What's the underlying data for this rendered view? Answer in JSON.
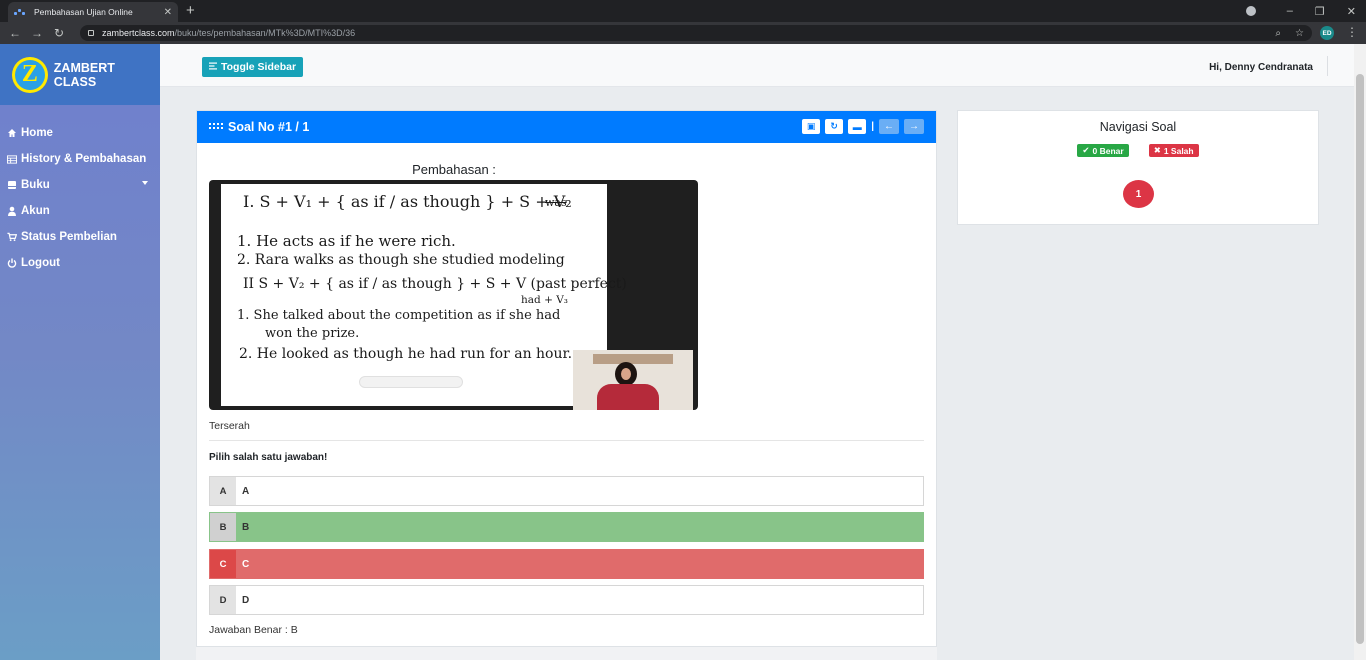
{
  "browser": {
    "tab_title": "Pembahasan Ujian Online",
    "url_host": "zambertclass.com",
    "url_path": "/buku/tes/pembahasan/MTk%3D/MTI%3D/36",
    "profile_initials": "ED"
  },
  "sidebar": {
    "logo_letter": "Z",
    "brand": "ZAMBERT CLASS",
    "items": [
      {
        "label": "Home",
        "icon": "home-icon"
      },
      {
        "label": "History & Pembahasan",
        "icon": "table-icon"
      },
      {
        "label": "Buku",
        "icon": "book-icon"
      },
      {
        "label": "Akun",
        "icon": "user-icon"
      },
      {
        "label": "Status Pembelian",
        "icon": "cart-icon"
      },
      {
        "label": "Logout",
        "icon": "power-icon"
      }
    ]
  },
  "topbar": {
    "toggle_label": "Toggle Sidebar",
    "greeting": "Hi, Denny Cendranata"
  },
  "question": {
    "header": "Soal No #1 / 1",
    "pembahasan_title": "Pembahasan :",
    "explanation_text": "Terserah",
    "instruction": "Pilih salah satu jawaban!",
    "options": [
      {
        "letter": "A",
        "text": "A",
        "state": "normal"
      },
      {
        "letter": "B",
        "text": "B",
        "state": "correct"
      },
      {
        "letter": "C",
        "text": "C",
        "state": "wrong"
      },
      {
        "letter": "D",
        "text": "D",
        "state": "normal"
      }
    ],
    "answer_text": "Jawaban Benar : B"
  },
  "whiteboard": {
    "lines": [
      "I.  S + V₁ + { as if / as though } + S + V₂",
      "1.  He acts as if he were rich.",
      "2.  Rara walks as though she studied modeling",
      "II  S + V₂ + { as if / as though } + S + V (past perfect)",
      "had + V₃",
      "1.  She talked about the competition as if she had",
      "won the prize.",
      "2.  He looked as though he had run for an hour.",
      "was"
    ]
  },
  "navigation": {
    "title": "Navigasi Soal",
    "benar": "0 Benar",
    "salah": "1 Salah",
    "numbers": [
      "1"
    ]
  },
  "colors": {
    "primary": "#007bff",
    "info": "#17a2b8",
    "success": "#28a745",
    "danger": "#dc3545",
    "correct_option": "#88c489",
    "wrong_option": "#e06b6b"
  }
}
